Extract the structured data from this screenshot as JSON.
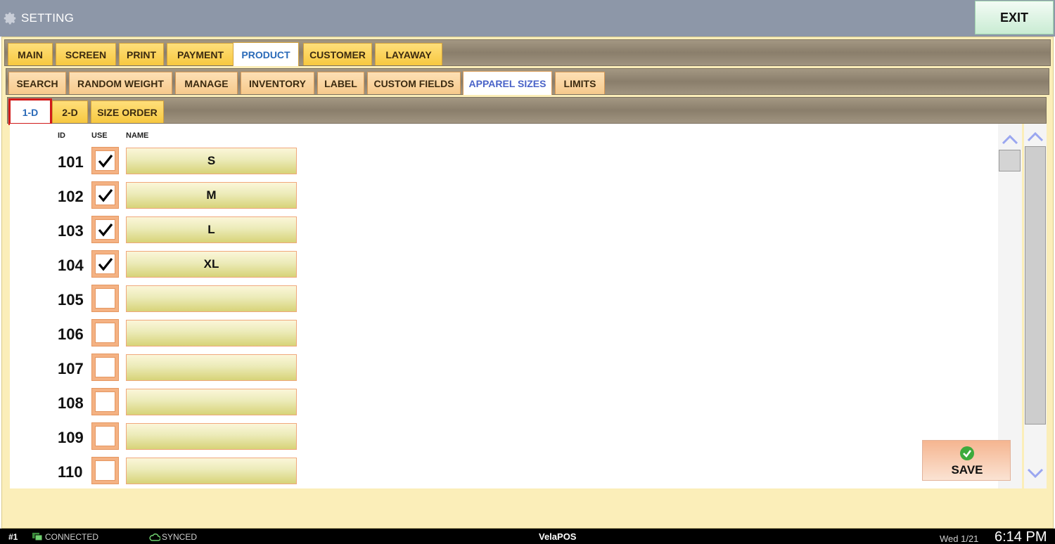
{
  "window": {
    "title": "SETTING",
    "exit_label": "EXIT"
  },
  "tabs_main": [
    "MAIN",
    "SCREEN",
    "PRINT",
    "PAYMENT",
    "PRODUCT",
    "CUSTOMER",
    "LAYAWAY"
  ],
  "tabs_main_active": "PRODUCT",
  "tabs_product": [
    "SEARCH",
    "RANDOM WEIGHT",
    "MANAGE",
    "INVENTORY",
    "LABEL",
    "CUSTOM FIELDS",
    "APPAREL SIZES",
    "LIMITS"
  ],
  "tabs_product_active": "APPAREL SIZES",
  "tabs_sizes": [
    "1-D",
    "2-D",
    "SIZE ORDER"
  ],
  "tabs_sizes_active": "1-D",
  "columns": {
    "id": "ID",
    "use": "USE",
    "name": "NAME"
  },
  "rows": [
    {
      "id": "101",
      "use": true,
      "name": "S"
    },
    {
      "id": "102",
      "use": true,
      "name": "M"
    },
    {
      "id": "103",
      "use": true,
      "name": "L"
    },
    {
      "id": "104",
      "use": true,
      "name": "XL"
    },
    {
      "id": "105",
      "use": false,
      "name": ""
    },
    {
      "id": "106",
      "use": false,
      "name": ""
    },
    {
      "id": "107",
      "use": false,
      "name": ""
    },
    {
      "id": "108",
      "use": false,
      "name": ""
    },
    {
      "id": "109",
      "use": false,
      "name": ""
    },
    {
      "id": "110",
      "use": false,
      "name": ""
    }
  ],
  "save_label": "SAVE",
  "status": {
    "terminal": "#1",
    "connection": "CONNECTED",
    "sync": "SYNCED",
    "app": "VelaPOS",
    "date": "Wed 1/21",
    "time": "6:14 PM"
  },
  "icons": {
    "title": "gear-icon",
    "save": "check-circle-icon",
    "scroll_up": "chevron-up-icon",
    "scroll_down": "chevron-down-icon",
    "connection": "network-icon",
    "sync": "cloud-icon"
  },
  "colors": {
    "active_tab_text": "#2a6ab8",
    "save_check": "#3caa3c",
    "highlight_border": "#d11a1a"
  }
}
